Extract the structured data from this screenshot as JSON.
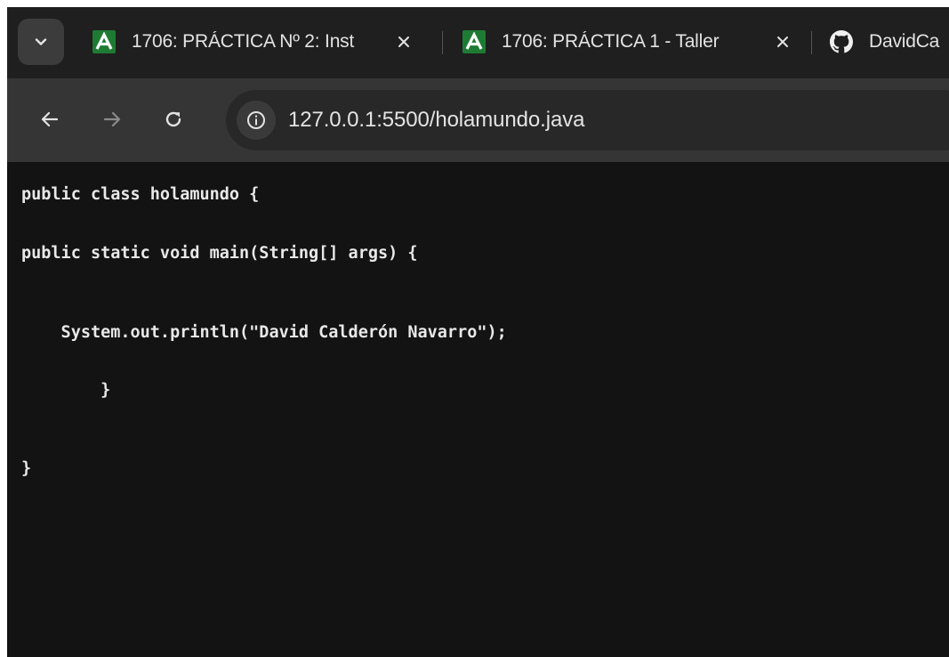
{
  "browser": {
    "tabs": [
      {
        "title": "1706: PRÁCTICA Nº 2: Inst",
        "favicon": "moodle-a-icon",
        "close_label": "×"
      },
      {
        "title": "1706: PRÁCTICA 1 - Taller",
        "favicon": "moodle-a-icon",
        "close_label": "×"
      },
      {
        "title": "DavidCa",
        "favicon": "github-icon"
      }
    ],
    "address_bar": {
      "url": "127.0.0.1:5500/holamundo.java"
    }
  },
  "colors": {
    "page_background": "#131313",
    "tab_strip": "#1f1f1f",
    "toolbar": "#353535",
    "moodle_green": "#1e7b34",
    "text": "#e3e3e3"
  },
  "document": {
    "lines": [
      "public class holamundo {",
      "public static void main(String[] args) {",
      "    System.out.println(\"David Calderón Navarro\");",
      "        }",
      "}"
    ]
  }
}
